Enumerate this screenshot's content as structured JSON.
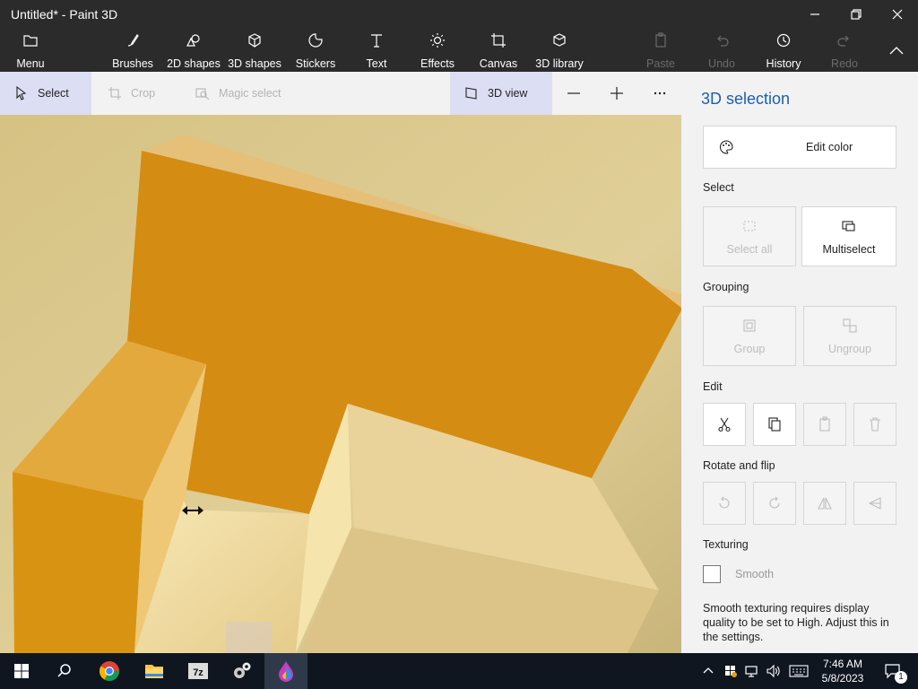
{
  "window": {
    "title": "Untitled* - Paint 3D",
    "controls": [
      "minimize-icon",
      "restore-icon",
      "close-icon"
    ]
  },
  "ribbon": {
    "menu": "Menu",
    "tools": [
      {
        "label": "Brushes",
        "icon": "brush-icon"
      },
      {
        "label": "2D shapes",
        "icon": "2d-shapes-icon"
      },
      {
        "label": "3D shapes",
        "icon": "3d-shapes-icon"
      },
      {
        "label": "Stickers",
        "icon": "stickers-icon"
      },
      {
        "label": "Text",
        "icon": "text-icon"
      },
      {
        "label": "Effects",
        "icon": "effects-icon"
      },
      {
        "label": "Canvas",
        "icon": "canvas-icon"
      },
      {
        "label": "3D library",
        "icon": "3d-library-icon"
      }
    ],
    "actions": [
      {
        "label": "Paste",
        "icon": "paste-icon",
        "enabled": false
      },
      {
        "label": "Undo",
        "icon": "undo-icon",
        "enabled": false
      },
      {
        "label": "History",
        "icon": "history-icon",
        "enabled": true
      },
      {
        "label": "Redo",
        "icon": "redo-icon",
        "enabled": false
      }
    ]
  },
  "toolbar": {
    "select": "Select",
    "crop": "Crop",
    "magic_select": "Magic select",
    "view_3d": "3D view",
    "zoom_out": "zoom-out-icon",
    "zoom_in": "zoom-in-icon",
    "more": "more-icon"
  },
  "panel": {
    "title": "3D selection",
    "edit_color": "Edit color",
    "sections": {
      "select": "Select",
      "grouping": "Grouping",
      "edit": "Edit",
      "rotate_flip": "Rotate and flip",
      "texturing": "Texturing"
    },
    "select_all": "Select all",
    "multiselect": "Multiselect",
    "group": "Group",
    "ungroup": "Ungroup",
    "edit_icons": [
      "cut-icon",
      "copy-icon",
      "paste-icon",
      "delete-icon"
    ],
    "rotate_icons": [
      "rotate-left-icon",
      "rotate-right-icon",
      "flip-horizontal-icon",
      "flip-vertical-icon"
    ],
    "smooth": "Smooth",
    "note": "Smooth texturing requires display quality to be set to High. Adjust this in the settings."
  },
  "taskbar": {
    "apps": [
      "windows-start-icon",
      "search-icon",
      "chrome-icon",
      "file-explorer-icon",
      "7zip-icon",
      "settings-gears-icon",
      "paint3d-icon"
    ],
    "time": "7:46 AM",
    "date": "5/8/2023",
    "notifications": "1"
  },
  "colors": {
    "accent": "#1f5fa8",
    "object_orange": "#d9900f",
    "object_light": "#f0d89a"
  }
}
